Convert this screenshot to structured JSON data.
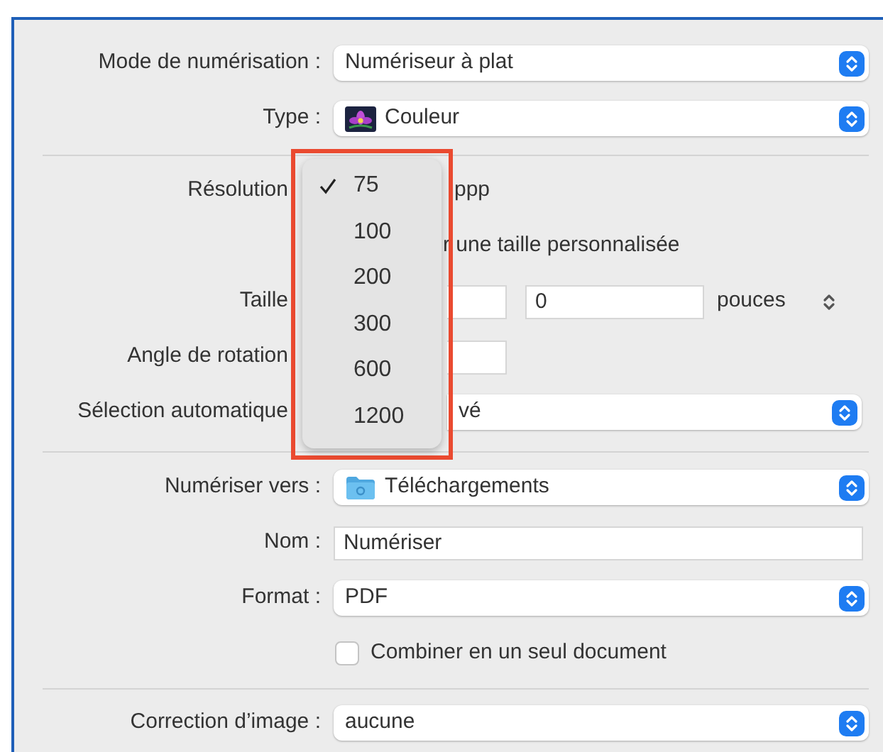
{
  "sections": [
    {
      "rows": [
        {
          "kind": "select",
          "label": "Mode de numérisation :",
          "value": "Numériseur à plat"
        },
        {
          "kind": "select",
          "label": "Type :",
          "value": "Couleur"
        }
      ]
    },
    {
      "rows": [
        {
          "kind": "unit",
          "label": "Résolution",
          "unit": "ppp"
        },
        {
          "kind": "partial_checkbox",
          "label": "r une taille personnalisée"
        },
        {
          "kind": "size",
          "label": "Taille",
          "value": "0",
          "unit": "pouces"
        },
        {
          "kind": "angle",
          "label": "Angle de rotation"
        },
        {
          "kind": "partial_select",
          "label": "Sélection automatique",
          "value": "vé"
        }
      ]
    },
    {
      "rows": [
        {
          "kind": "select",
          "label": "Numériser vers :",
          "value": "Téléchargements"
        },
        {
          "kind": "field",
          "label": "Nom :",
          "value": "Numériser"
        },
        {
          "kind": "select",
          "label": "Format :",
          "value": "PDF"
        },
        {
          "kind": "checkbox",
          "label": "Combiner en un seul document",
          "checked": false
        }
      ]
    },
    {
      "rows": [
        {
          "kind": "select",
          "label": "Correction d’image :",
          "value": "aucune"
        }
      ]
    }
  ],
  "menu": {
    "items": [
      {
        "label": "75",
        "selected": true
      },
      {
        "label": "100",
        "selected": false
      },
      {
        "label": "200",
        "selected": false
      },
      {
        "label": "300",
        "selected": false
      },
      {
        "label": "600",
        "selected": false
      },
      {
        "label": "1200",
        "selected": false
      }
    ]
  }
}
